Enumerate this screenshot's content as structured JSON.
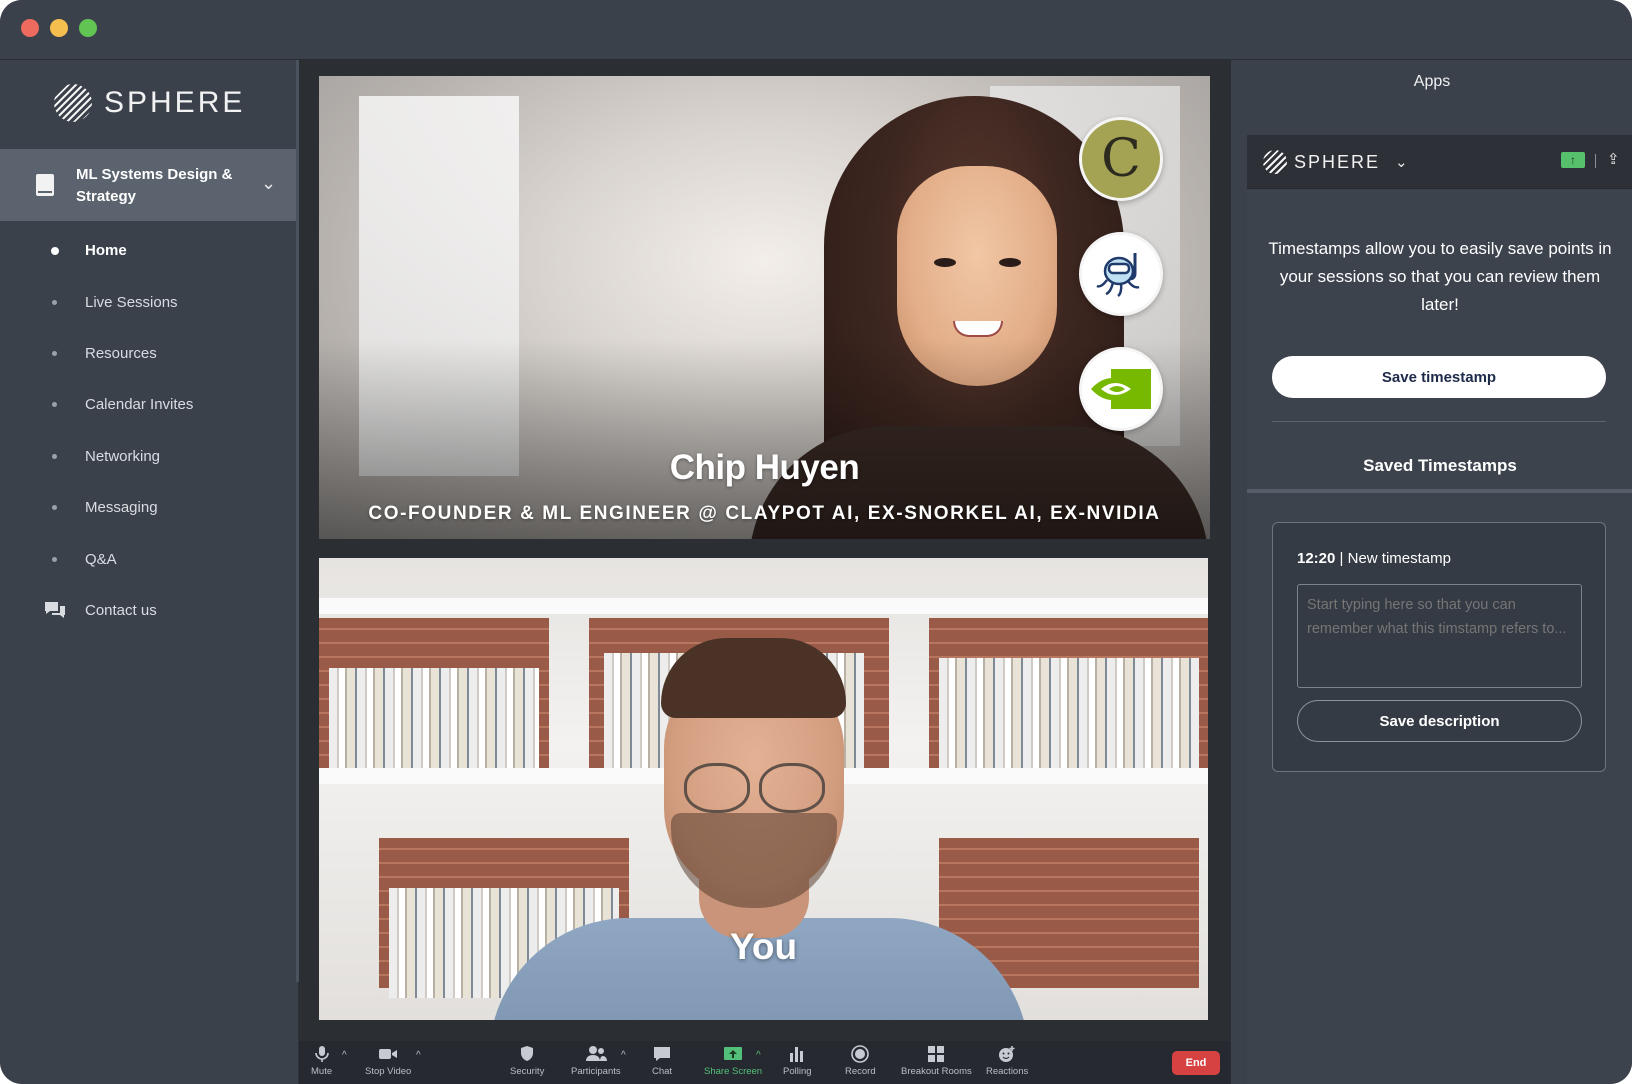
{
  "brand": {
    "name": "SPHERE"
  },
  "course": {
    "title": "ML Systems Design & Strategy"
  },
  "nav": {
    "items": [
      {
        "label": "Home",
        "active": true
      },
      {
        "label": "Live Sessions"
      },
      {
        "label": "Resources"
      },
      {
        "label": "Calendar Invites"
      },
      {
        "label": "Networking"
      },
      {
        "label": "Messaging"
      },
      {
        "label": "Q&A"
      },
      {
        "label": "Contact us",
        "icon": "chat-bubbles-icon"
      }
    ]
  },
  "videos": {
    "speaker": {
      "name": "Chip Huyen",
      "role": "CO-FOUNDER & ML ENGINEER @ CLAYPOT AI, EX-SNORKEL AI, EX-NVIDIA",
      "badges": [
        {
          "name": "claypot-logo",
          "letter": "C"
        },
        {
          "name": "snorkel-logo"
        },
        {
          "name": "nvidia-logo"
        }
      ]
    },
    "self": {
      "label": "You"
    }
  },
  "toolbar": {
    "mute": "Mute",
    "stop_video": "Stop Video",
    "security": "Security",
    "participants": "Participants",
    "chat": "Chat",
    "share_screen": "Share Screen",
    "polling": "Polling",
    "record": "Record",
    "breakout_rooms": "Breakout Rooms",
    "reactions": "Reactions",
    "end": "End"
  },
  "apps": {
    "title": "Apps",
    "app_name": "SPHERE",
    "intro": "Timestamps allow you to easily save points in your sessions so that you can review them later!",
    "save_timestamp": "Save timestamp",
    "saved_title": "Saved Timestamps",
    "timestamp": {
      "time": "12:20",
      "separator": " | ",
      "title": "New timestamp",
      "placeholder": "Start typing here so that you can remember what this timstamp refers to...",
      "save_label": "Save description"
    }
  },
  "colors": {
    "window_bg": "#2e3138",
    "sidebar_bg": "#3a414b",
    "active_item_bg": "#5b636e",
    "share_green": "#53c07a",
    "end_red": "#d64141"
  }
}
